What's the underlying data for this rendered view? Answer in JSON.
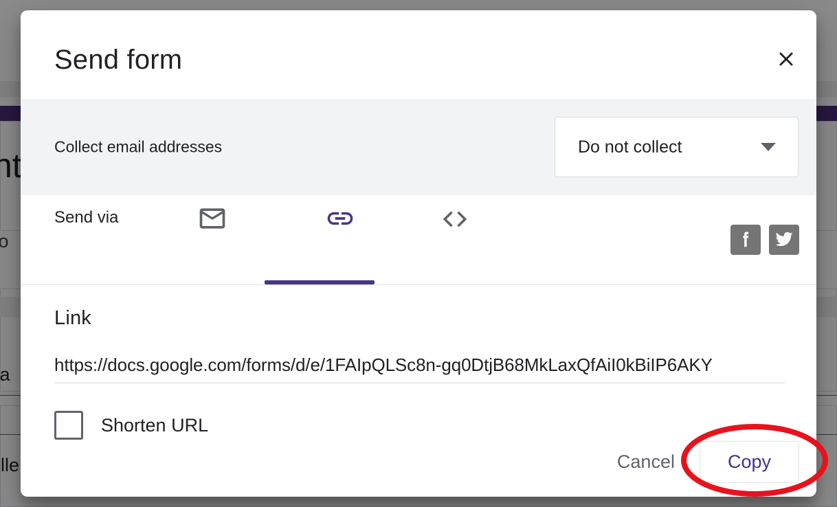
{
  "dialog": {
    "title": "Send form",
    "close_icon": "close-icon",
    "collect": {
      "label": "Collect email addresses",
      "selected_option": "Do not collect",
      "dropdown_icon": "chevron-down-icon"
    },
    "send_via": {
      "label": "Send via",
      "tabs": [
        {
          "id": "email",
          "icon": "email-icon",
          "active": false
        },
        {
          "id": "link",
          "icon": "link-icon",
          "active": true
        },
        {
          "id": "embed",
          "icon": "embed-code-icon",
          "active": false
        }
      ],
      "social": [
        {
          "id": "facebook",
          "icon": "facebook-icon"
        },
        {
          "id": "twitter",
          "icon": "twitter-icon"
        }
      ],
      "active_color": "#49348a",
      "inactive_color": "#5f6368"
    },
    "link": {
      "heading": "Link",
      "url": "https://docs.google.com/forms/d/e/1FAIpQLSc8n-gq0DtjB68MkLaxQfAiI0kBiIP6AKY",
      "shorten_label": "Shorten URL",
      "shorten_checked": false
    },
    "actions": {
      "cancel_label": "Cancel",
      "copy_label": "Copy",
      "copy_color": "#4a2d8a"
    }
  },
  "background": {
    "form_title_fragment": "nt",
    "form_subtitle_fragment": "fo",
    "question_fragment_1": "va",
    "question_fragment_2": "elle",
    "accent_color": "#4a2d7a"
  },
  "annotation": {
    "shape": "ellipse",
    "color": "#e8121d",
    "target": "copy-button"
  }
}
